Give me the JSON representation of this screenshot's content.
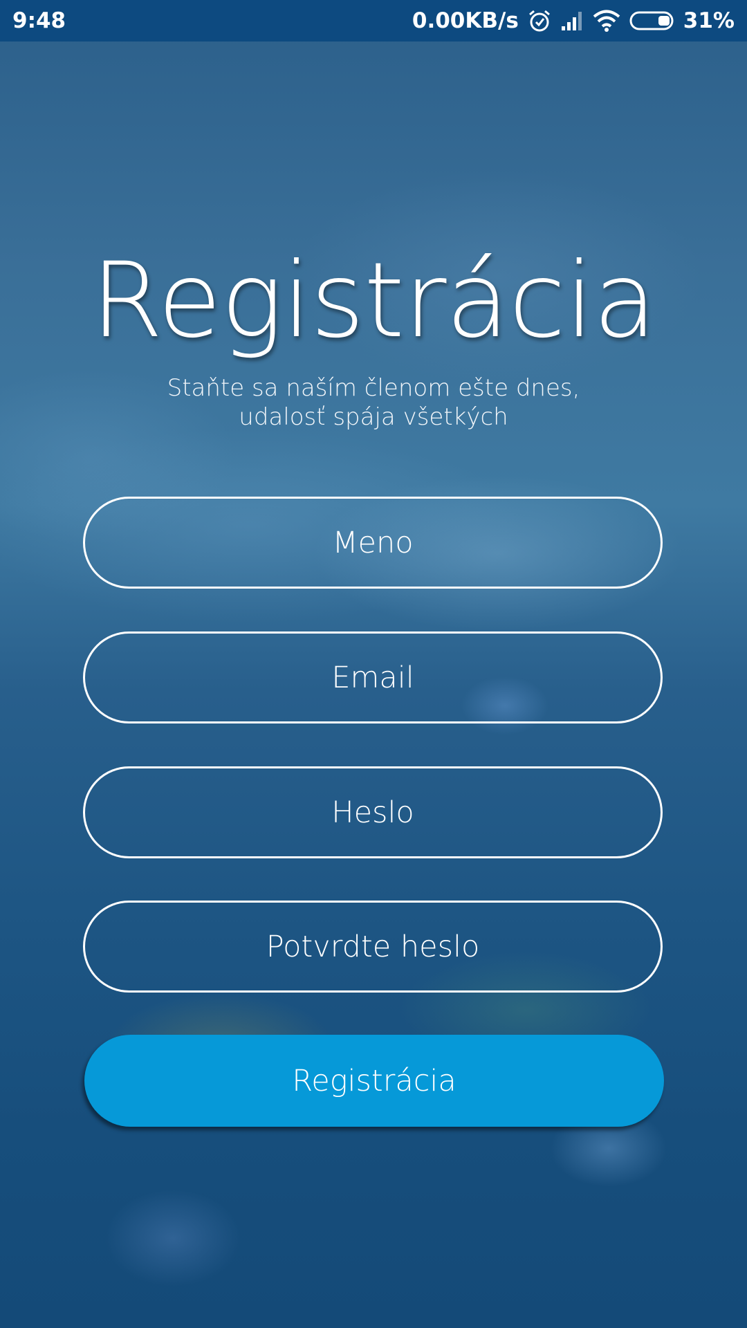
{
  "status_bar": {
    "time": "9:48",
    "network_speed": "0.00KB/s",
    "battery_percent": "31%",
    "battery_level": 0.31,
    "icons": [
      "alarm-icon",
      "signal-icon",
      "wifi-icon",
      "battery-icon"
    ]
  },
  "colors": {
    "status_bar_bg": "#0d4a80",
    "button_bg": "#0699d8",
    "text": "#ffffff",
    "field_border": "#ffffff"
  },
  "header": {
    "title": "Registrácia",
    "subtitle_line1": "Staňte sa naším členom ešte dnes,",
    "subtitle_line2": "udalosť spája všetkých"
  },
  "form": {
    "name_placeholder": "Meno",
    "email_placeholder": "Email",
    "password_placeholder": "Heslo",
    "confirm_password_placeholder": "Potvrdte heslo",
    "submit_label": "Registrácia"
  }
}
